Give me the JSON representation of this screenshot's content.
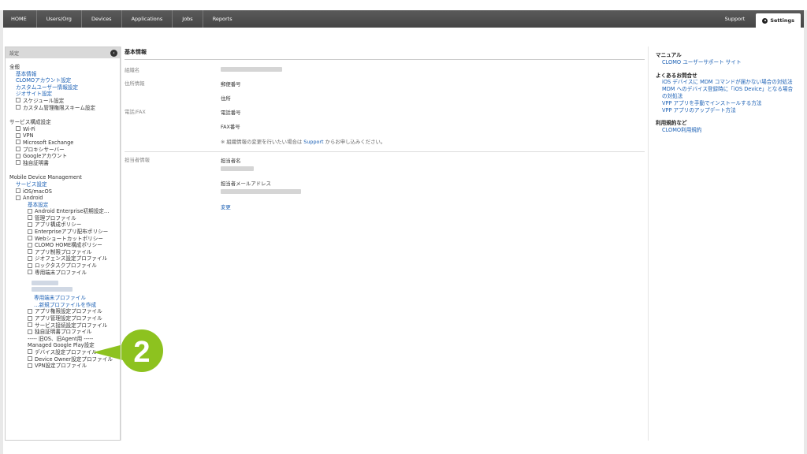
{
  "nav": {
    "items": [
      "HOME",
      "Users/Org",
      "Devices",
      "Applications",
      "Jobs",
      "Reports"
    ],
    "support": "Support",
    "settings": "Settings"
  },
  "sidebar": {
    "header": "設定",
    "collapse_icon": "chevron-left-icon",
    "general": {
      "heading": "全般",
      "links": [
        "基本情報",
        "CLOMOアカウント設定",
        "カスタムユーザー情報設定",
        "ジオサイト設定"
      ],
      "items": [
        "スケジュール設定",
        "カスタム管理権限スキーム設定"
      ]
    },
    "service": {
      "heading": "サービス構成設定",
      "items": [
        "Wi-Fi",
        "VPN",
        "Microsoft Exchange",
        "プロキシサーバー",
        "Googleアカウント",
        "独自証明書"
      ]
    },
    "mdm": {
      "heading": "Mobile Device Management",
      "service_link": "サービス設定",
      "ios": "iOS/macOS",
      "android": "Android",
      "basic_link": "基本設定",
      "items_a": [
        "Android Enterprise初期設定…",
        "管理プロファイル",
        "アプリ構成ポリシー",
        "Enterpriseアプリ配布ポリシー",
        "Webショートカットポリシー",
        "CLOMO HOME構成ポリシー",
        "アプリ制限プロファイル",
        "ジオフェンス設定プロファイル",
        "ロックタスクプロファイル",
        "専用端末プロファイル"
      ],
      "profile_link": "専用端末プロファイル",
      "new_link": "…新規プロファイルを作成",
      "items_b": [
        "アプリ権限設定プロファイル",
        "アプリ管理設定プロファイル",
        "サービス接続設定プロファイル",
        "独自証明書プロファイル"
      ],
      "divider_text": "----- 旧OS、旧Agent用 -----",
      "managed_gp": "Managed Google Play設定",
      "items_c": [
        "デバイス設定プロファイル",
        "Device Owner設定プロファイル",
        "VPN設定プロファイル"
      ]
    }
  },
  "main": {
    "title": "基本情報",
    "org_label": "組織名",
    "address_label": "住所情報",
    "postal_label": "郵便番号",
    "address_field_label": "住所",
    "phone_group_label": "電話/FAX",
    "phone_label": "電話番号",
    "fax_label": "FAX番号",
    "note_prefix": "※ 組織情報の変更を行いたい場合は ",
    "note_link": "Support",
    "note_suffix": " からお申し込みください。",
    "contact_group_label": "担当者情報",
    "contact_name_label": "担当者名",
    "contact_email_label": "担当者メールアドレス",
    "change_link": "変更"
  },
  "right": {
    "manual_heading": "マニュアル",
    "manual_link": "CLOMO ユーザーサポート サイト",
    "faq_heading": "よくあるお問合せ",
    "faq_links": [
      "iOS デバイスに MDM コマンドが届かない場合の対処法",
      "MDM へのデバイス登録時に「iOS Device」となる場合の対処法",
      "VPP アプリを手動でインストールする方法",
      "VPP アプリのアップデート方法"
    ],
    "terms_heading": "利用規約など",
    "terms_link": "CLOMO利用規約"
  },
  "callout": {
    "number": "2",
    "color": "#8dc21f"
  }
}
